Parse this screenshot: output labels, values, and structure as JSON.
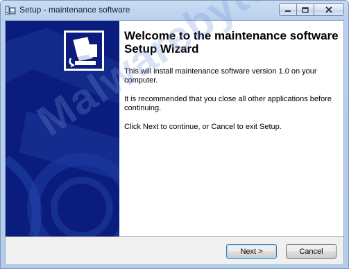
{
  "window": {
    "title": "Setup - maintenance software",
    "app_icon": "setup-installer-icon",
    "caption_buttons": [
      "minimize",
      "maximize",
      "close"
    ]
  },
  "sidebar": {
    "logo_icon": "computer-install-icon",
    "background_color": "#0a1c7d"
  },
  "content": {
    "heading": "Welcome to the maintenance software Setup Wizard",
    "paragraphs": [
      "This will install maintenance software version 1.0 on your computer.",
      "It is recommended that you close all other applications before continuing.",
      "Click Next to continue, or Cancel to exit Setup."
    ]
  },
  "buttons": {
    "next_label": "Next >",
    "cancel_label": "Cancel"
  },
  "watermark": {
    "text": "Malwarebytes"
  }
}
